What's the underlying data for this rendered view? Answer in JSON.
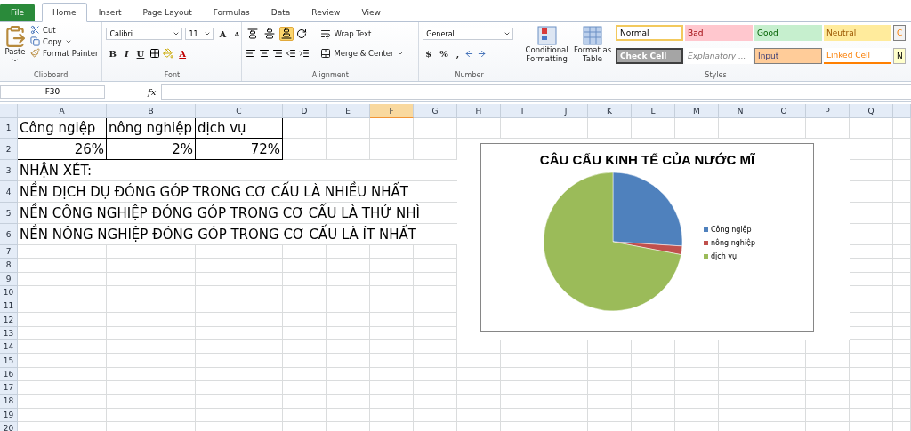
{
  "tabs": [
    {
      "label": "File",
      "kind": "file",
      "selected": false
    },
    {
      "label": "Home",
      "kind": "tab",
      "selected": true
    },
    {
      "label": "Insert",
      "kind": "tab",
      "selected": false
    },
    {
      "label": "Page Layout",
      "kind": "tab",
      "selected": false
    },
    {
      "label": "Formulas",
      "kind": "tab",
      "selected": false
    },
    {
      "label": "Data",
      "kind": "tab",
      "selected": false
    },
    {
      "label": "Review",
      "kind": "tab",
      "selected": false
    },
    {
      "label": "View",
      "kind": "tab",
      "selected": false
    }
  ],
  "ribbon": {
    "clipboard": {
      "label": "Clipboard",
      "paste": "Paste",
      "cut": "Cut",
      "copy": "Copy",
      "painter": "Format Painter"
    },
    "font": {
      "label": "Font",
      "name": "Calibri",
      "size": "11",
      "grow": "A",
      "shrink": "A",
      "styles": [
        "B",
        "I",
        "U"
      ],
      "color_button": "A"
    },
    "alignment": {
      "label": "Alignment",
      "vertical": [
        {
          "selected": false
        },
        {
          "selected": false
        },
        {
          "selected": true
        }
      ],
      "wrap": "Wrap Text",
      "merge": "Merge & Center"
    },
    "number": {
      "label": "Number",
      "format": "General",
      "symbols": [
        "$",
        "%",
        ","
      ]
    },
    "styles": {
      "label": "Styles",
      "conditional": "Conditional Formatting",
      "table": "Format as Table",
      "cells": [
        {
          "label": "Normal",
          "kind": "normal"
        },
        {
          "label": "Bad",
          "kind": "bad"
        },
        {
          "label": "Good",
          "kind": "good"
        },
        {
          "label": "Neutral",
          "kind": "neutral"
        },
        {
          "label": "C",
          "kind": "calculation"
        },
        {
          "label": "Check Cell",
          "kind": "check"
        },
        {
          "label": "Explanatory ...",
          "kind": "explanatory"
        },
        {
          "label": "Input",
          "kind": "input"
        },
        {
          "label": "Linked Cell",
          "kind": "linked"
        },
        {
          "label": "N",
          "kind": "note"
        }
      ]
    }
  },
  "formula_bar": {
    "name_box": "F30",
    "fx": "fx"
  },
  "sheet": {
    "columns": [
      {
        "label": "A",
        "selected": false
      },
      {
        "label": "B",
        "selected": false
      },
      {
        "label": "C",
        "selected": false
      },
      {
        "label": "D",
        "selected": false
      },
      {
        "label": "E",
        "selected": false
      },
      {
        "label": "F",
        "selected": true
      },
      {
        "label": "G",
        "selected": false
      },
      {
        "label": "H",
        "selected": false
      },
      {
        "label": "I",
        "selected": false
      },
      {
        "label": "J",
        "selected": false
      },
      {
        "label": "K",
        "selected": false
      },
      {
        "label": "L",
        "selected": false
      },
      {
        "label": "M",
        "selected": false
      },
      {
        "label": "N",
        "selected": false
      },
      {
        "label": "O",
        "selected": false
      },
      {
        "label": "P",
        "selected": false
      },
      {
        "label": "Q",
        "selected": false
      }
    ],
    "rows": [
      {
        "number": "1",
        "kind": "labels",
        "cells": [
          "Công ngiệp",
          "nông nghiệp",
          "dịch vụ"
        ]
      },
      {
        "number": "2",
        "kind": "values",
        "cells": [
          "26%",
          "2%",
          "72%"
        ]
      },
      {
        "number": "3",
        "kind": "note",
        "cells": [
          "NHẬN XÉT:"
        ]
      },
      {
        "number": "4",
        "kind": "note",
        "cells": [
          "NỀN DỊCH DỤ ĐÓNG GÓP TRONG CƠ CẤU LÀ NHIỀU NHẤT"
        ]
      },
      {
        "number": "5",
        "kind": "note",
        "cells": [
          "NỀN CÔNG NGHIỆP ĐÓNG GÓP TRONG CƠ CẤU LÀ THỨ NHÌ"
        ]
      },
      {
        "number": "6",
        "kind": "note",
        "cells": [
          "NỀN NÔNG NGHIỆP ĐÓNG GÓP TRONG CƠ CẤU LÀ ÍT NHẤT"
        ]
      },
      {
        "number": "7",
        "kind": "empty"
      },
      {
        "number": "8",
        "kind": "empty"
      },
      {
        "number": "9",
        "kind": "empty"
      },
      {
        "number": "10",
        "kind": "empty"
      },
      {
        "number": "11",
        "kind": "empty"
      },
      {
        "number": "12",
        "kind": "empty"
      },
      {
        "number": "13",
        "kind": "empty"
      },
      {
        "number": "14",
        "kind": "empty"
      },
      {
        "number": "15",
        "kind": "empty"
      },
      {
        "number": "16",
        "kind": "empty"
      },
      {
        "number": "17",
        "kind": "empty"
      },
      {
        "number": "18",
        "kind": "empty"
      },
      {
        "number": "19",
        "kind": "empty"
      },
      {
        "number": "20",
        "kind": "empty"
      }
    ],
    "chart": {
      "legend": [
        {
          "color": "#4f81bd"
        },
        {
          "color": "#c0504d"
        },
        {
          "color": "#9bbb59"
        }
      ],
      "chart_data": {
        "type": "pie",
        "title": "CÂU CẤU KINH TẾ CỦA NƯỚC MĨ",
        "categories": [
          "Công ngiệp",
          "nông nghiệp",
          "dịch vụ"
        ],
        "values": [
          26,
          2,
          72
        ]
      }
    }
  }
}
